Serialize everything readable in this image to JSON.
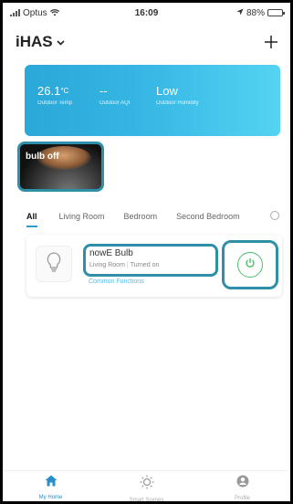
{
  "status_bar": {
    "carrier": "Optus",
    "time": "16:09",
    "battery": "88%",
    "battery_level": 0.88
  },
  "header": {
    "home_name": "iHAS",
    "add_icon": "plus-icon"
  },
  "weather": {
    "temp_value": "26.1",
    "temp_unit": "°C",
    "temp_label": "Outdoor Temp",
    "aqi_value": "--",
    "aqi_label": "Outdoor AQI",
    "humidity_value": "Low",
    "humidity_label": "Outdoor Humidity",
    "gradient": [
      "#2aa8d8",
      "#54d4f2"
    ]
  },
  "scene": {
    "label": "bulb off"
  },
  "rooms": {
    "tabs": [
      {
        "label": "All",
        "active": true
      },
      {
        "label": "Living Room",
        "active": false
      },
      {
        "label": "Bedroom",
        "active": false
      },
      {
        "label": "Second Bedroom",
        "active": false
      }
    ]
  },
  "device": {
    "name": "nowE Bulb",
    "room": "Living Room",
    "status": "Turned on",
    "common_functions": "Common Functions",
    "icon": "bulb-icon",
    "power_icon": "power-icon",
    "power_color": "#4cbf6a"
  },
  "nav": {
    "items": [
      {
        "label": "My Home",
        "icon": "home-icon",
        "active": true
      },
      {
        "label": "Smart Scenes",
        "icon": "sun-icon",
        "active": false
      },
      {
        "label": "Profile",
        "icon": "profile-icon",
        "active": false
      }
    ]
  },
  "colors": {
    "accent": "#2a8fc8",
    "highlight_outline": "#2f8fa8"
  }
}
